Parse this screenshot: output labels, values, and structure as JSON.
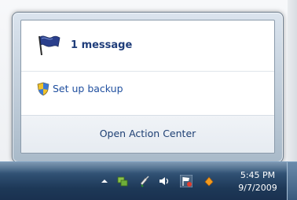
{
  "flyout": {
    "message_label": "1 message",
    "backup_label": "Set up backup",
    "footer_link": "Open Action Center"
  },
  "taskbar": {
    "clock_time": "5:45 PM",
    "clock_date": "9/7/2009",
    "tray_icons": [
      "chevron-up-icon",
      "network-icon",
      "power-icon",
      "volume-icon",
      "action-center-flag-icon",
      "orange-app-icon"
    ]
  },
  "colors": {
    "link_blue": "#1e4e9e",
    "taskbar_dark": "#1d3857"
  }
}
